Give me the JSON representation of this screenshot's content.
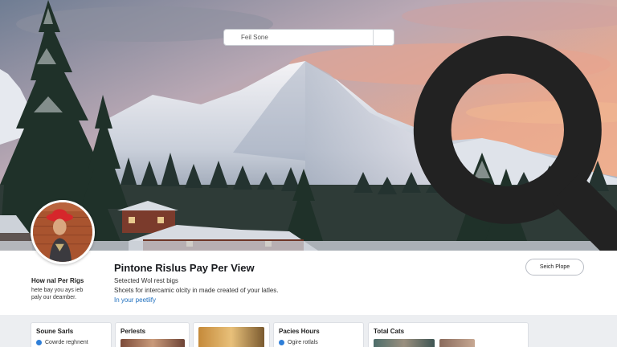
{
  "search": {
    "placeholder": "Feil Sone"
  },
  "profile": {
    "side_title": "How nal Per Rigs",
    "side_desc_line1": "hete bay you ays ieb",
    "side_desc_line2": "paly our deamber.",
    "title": "Pintone Rislus Pay Per View",
    "subtitle": "Setected Wol rest bigs",
    "description": "Shcets for intercamic olcity in made created of your latles.",
    "link": "In your peetlify",
    "action_button": "Seich Plope"
  },
  "cards": [
    {
      "title": "Soune Sarls",
      "line": "Cowrde reghnent"
    },
    {
      "title": "Perlests"
    },
    {
      "title": ""
    },
    {
      "title": "Pacies Hours",
      "line": "Ogire rotlals"
    },
    {
      "title": "Total Cats"
    }
  ],
  "colors": {
    "accent": "#2f7fd8",
    "link": "#1e6fbf"
  },
  "icons": {
    "search": "search-icon",
    "search_button": "search-icon"
  }
}
